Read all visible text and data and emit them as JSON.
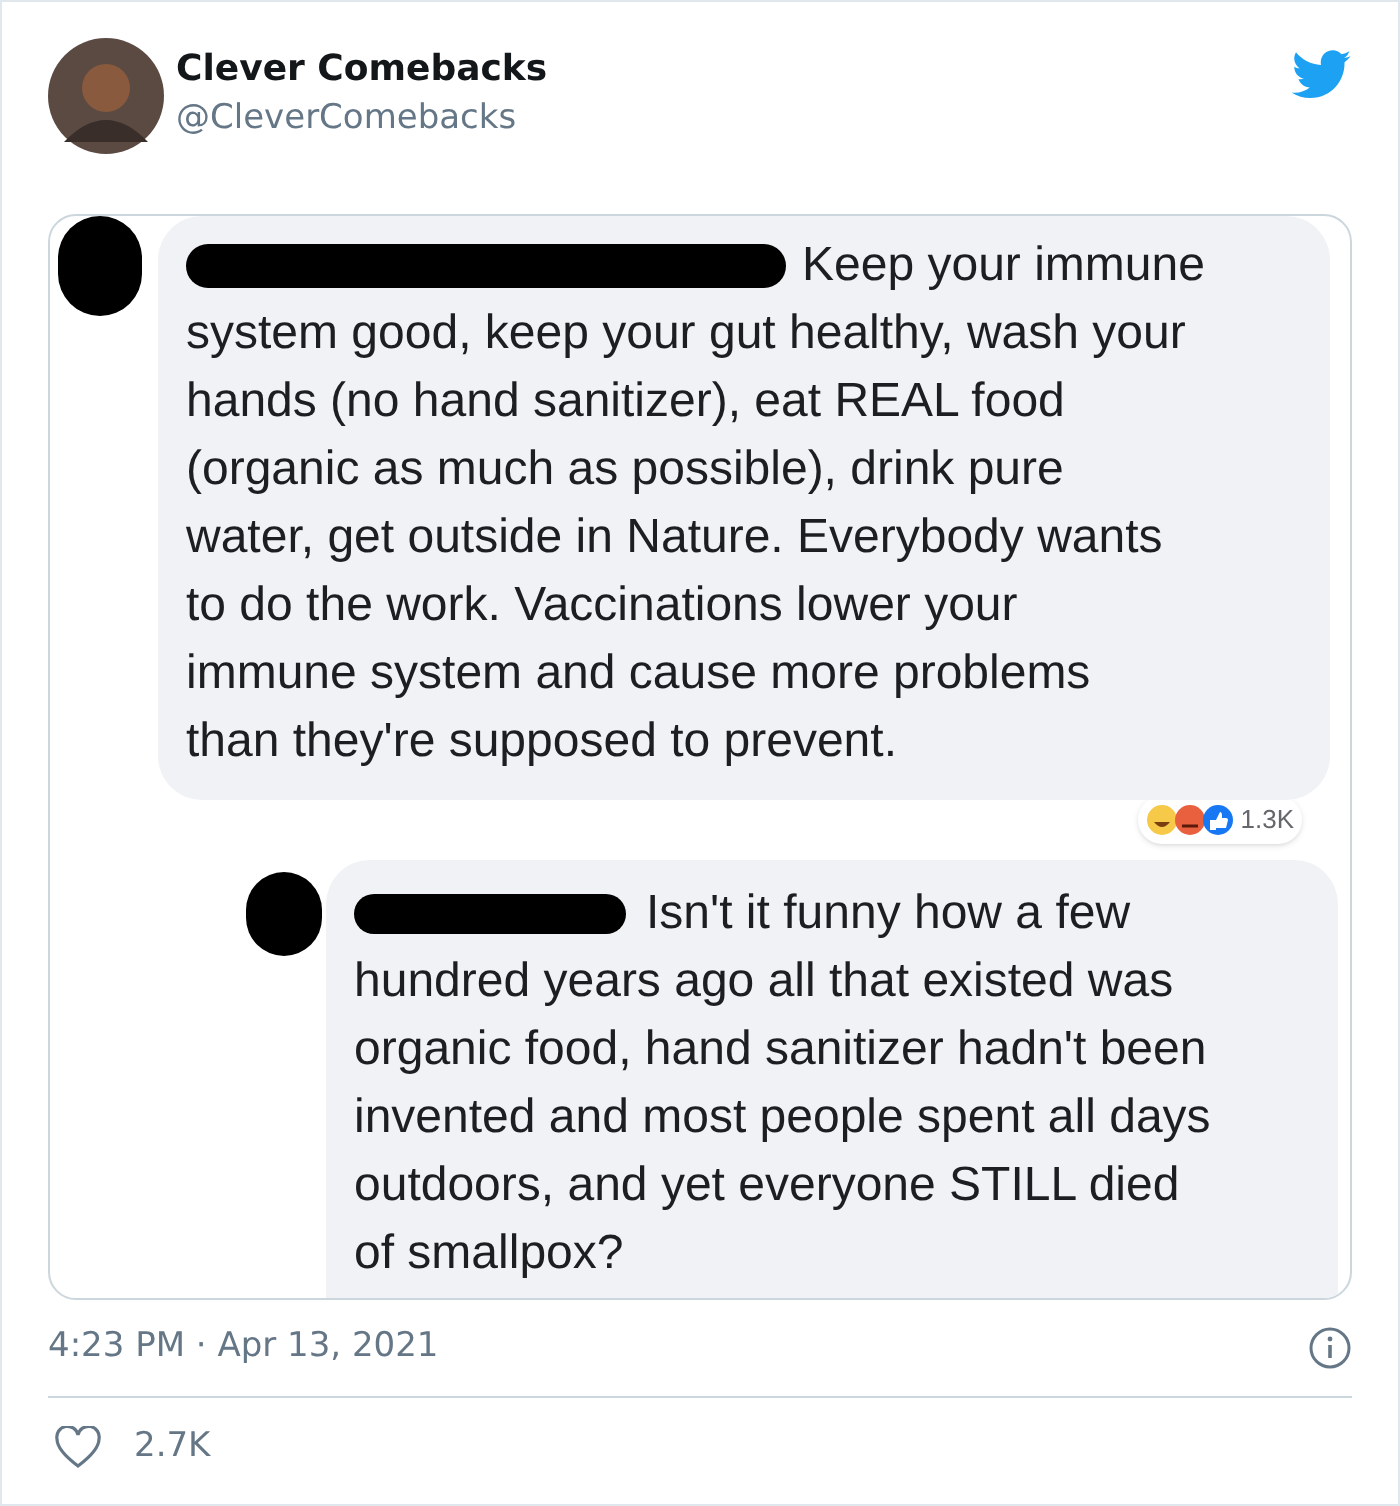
{
  "author": {
    "name": "Clever Comebacks",
    "handle": "@CleverComebacks"
  },
  "comments": [
    {
      "kind": "comment",
      "lines": [
        "Keep your immune",
        "system good, keep your gut healthy, wash your",
        "hands (no hand sanitizer), eat REAL food",
        "(organic as much as possible), drink pure",
        "water, get outside in Nature. Everybody wants",
        "to do the work. Vaccinations lower your",
        "immune system and cause more problems",
        "than they're supposed to prevent."
      ],
      "reactions": "1.3K"
    },
    {
      "kind": "reply",
      "lines": [
        "Isn't it funny how a few",
        "hundred years ago all that existed was",
        "organic food, hand sanitizer hadn't been",
        "invented and most people spent all days",
        "outdoors, and yet everyone STILL died",
        "of smallpox?"
      ]
    }
  ],
  "timestamp": "4:23 PM · Apr 13, 2021",
  "likes": "2.7K"
}
